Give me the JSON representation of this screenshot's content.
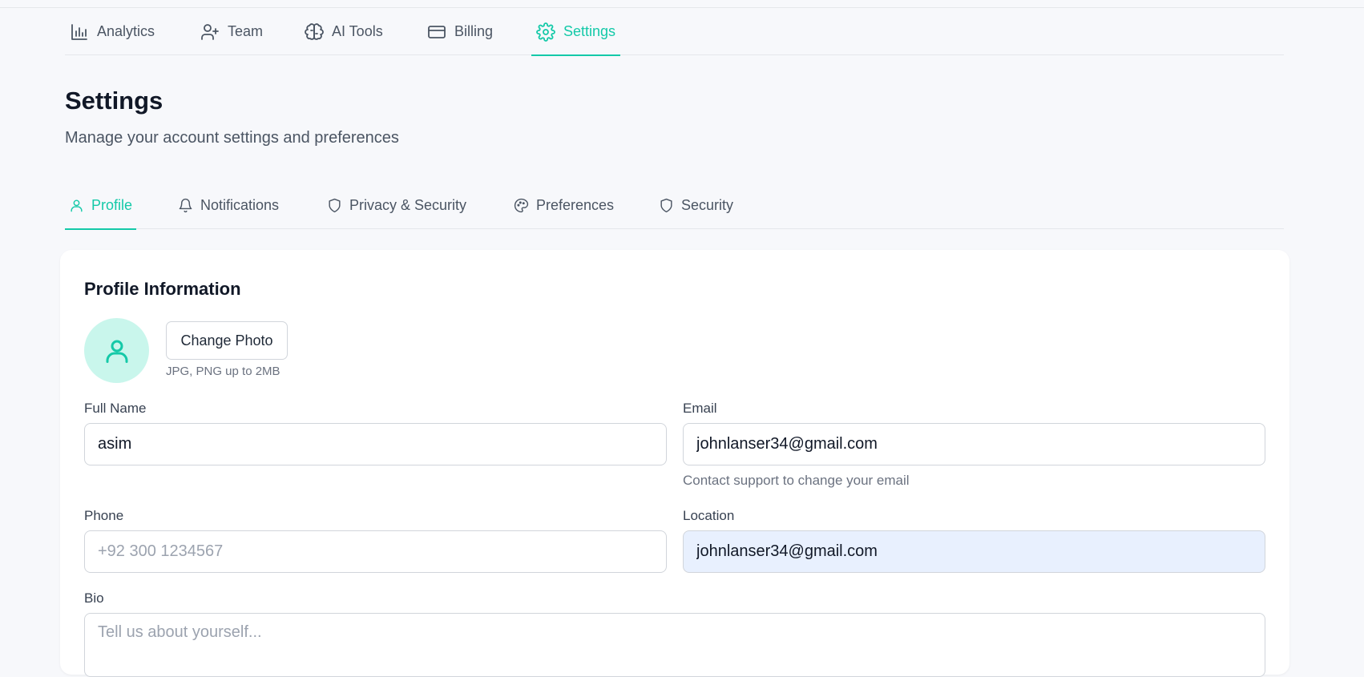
{
  "topnav": {
    "items": [
      {
        "label": "Analytics",
        "icon": "bar-chart-icon"
      },
      {
        "label": "Team",
        "icon": "user-plus-icon"
      },
      {
        "label": "AI Tools",
        "icon": "brain-icon"
      },
      {
        "label": "Billing",
        "icon": "credit-card-icon"
      },
      {
        "label": "Settings",
        "icon": "gear-icon",
        "active": true
      }
    ]
  },
  "page": {
    "title": "Settings",
    "subtitle": "Manage your account settings and preferences"
  },
  "tabs": [
    {
      "label": "Profile",
      "icon": "user-icon",
      "active": true
    },
    {
      "label": "Notifications",
      "icon": "bell-icon"
    },
    {
      "label": "Privacy & Security",
      "icon": "shield-icon"
    },
    {
      "label": "Preferences",
      "icon": "palette-icon"
    },
    {
      "label": "Security",
      "icon": "shield-icon"
    }
  ],
  "profile": {
    "title": "Profile Information",
    "change_photo_label": "Change Photo",
    "photo_hint": "JPG, PNG up to 2MB",
    "full_name": {
      "label": "Full Name",
      "value": "asim"
    },
    "email": {
      "label": "Email",
      "value": "johnlanser34@gmail.com",
      "hint": "Contact support to change your email"
    },
    "phone": {
      "label": "Phone",
      "value": "",
      "placeholder": "+92 300 1234567"
    },
    "location": {
      "label": "Location",
      "value": "johnlanser34@gmail.com"
    },
    "bio": {
      "label": "Bio",
      "value": "",
      "placeholder": "Tell us about yourself..."
    }
  },
  "colors": {
    "accent": "#14c9a8",
    "avatar_bg": "#c9f6ec",
    "autofill_bg": "#e8f0fe"
  }
}
